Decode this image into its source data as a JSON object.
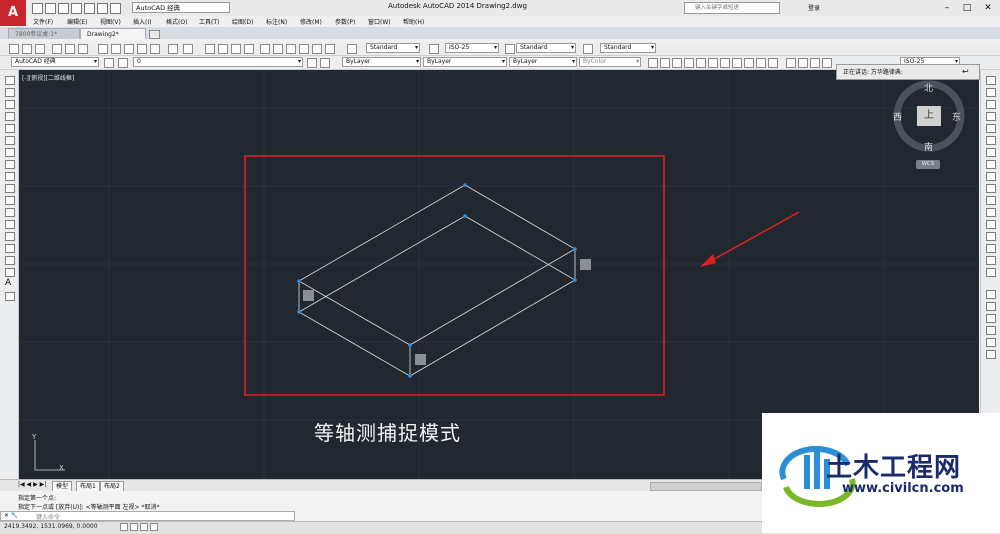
{
  "app": {
    "window_title": "Autodesk AutoCAD 2014    Drawing2.dwg",
    "workspace": "AutoCAD 经典",
    "search_placeholder": "键入关键字或短语",
    "login": "登录"
  },
  "menu": [
    "文件(F)",
    "编辑(E)",
    "视图(V)",
    "插入(I)",
    "格式(O)",
    "工具(T)",
    "绘图(D)",
    "标注(N)",
    "修改(M)",
    "参数(P)",
    "窗口(W)",
    "帮助(H)"
  ],
  "tabs": [
    {
      "label": "7800参议桌:1*"
    },
    {
      "label": "Drawing2*"
    }
  ],
  "styles": {
    "text_style": "Standard",
    "dim_style": "ISO-25",
    "table_style": "Standard",
    "mleader_style": "Standard",
    "right_dim_style": "ISO-25"
  },
  "layers": {
    "workspace2": "AutoCAD 经典",
    "current_layer": "0",
    "color": "ByLayer",
    "linetype": "ByLayer",
    "lineweight": "ByLayer",
    "plotstyle": "ByColor"
  },
  "viewport_label": "[-][俯视][二维线框]",
  "tooltip": "正在讲话: 万华路律典:",
  "viewcube": {
    "north": "北",
    "south": "南",
    "east": "东",
    "west": "西",
    "top": "上",
    "wcs": "WCS"
  },
  "caption": "等轴测捕捉模式",
  "layout_tabs": [
    "模型",
    "布局1",
    "布局2"
  ],
  "command": {
    "line1": "指定第一个点:",
    "line2": "指定下一点或 [放弃(U)]:  <等轴测平面 左视> *取消*",
    "placeholder": "键入命令"
  },
  "status": {
    "coords": "2419.3492, 1531.0969, 0.0000"
  },
  "watermark": {
    "title": "土木工程网",
    "url": "www.civilcn.com"
  },
  "colors": {
    "canvas": "#212830",
    "highlight_box": "#e02020",
    "arrow": "#e02020",
    "grip": "#2e8fe6"
  }
}
